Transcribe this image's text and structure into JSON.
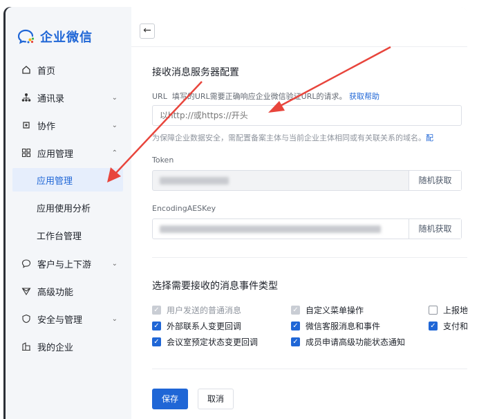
{
  "app": {
    "logo_text": "企业微信"
  },
  "sidebar": {
    "items": [
      {
        "label": "首页",
        "icon": "home-icon"
      },
      {
        "label": "通讯录",
        "icon": "org-chart-icon",
        "chevron": "chevron-down"
      },
      {
        "label": "协作",
        "icon": "collaboration-icon",
        "chevron": "chevron-down"
      },
      {
        "label": "应用管理",
        "icon": "apps-grid-icon",
        "chevron": "chevron-up"
      },
      {
        "label": "客户与上下游",
        "icon": "chat-bubble-icon",
        "chevron": "chevron-down"
      },
      {
        "label": "高级功能",
        "icon": "diamond-icon"
      },
      {
        "label": "安全与管理",
        "icon": "shield-icon",
        "chevron": "chevron-down"
      },
      {
        "label": "我的企业",
        "icon": "building-icon"
      }
    ],
    "sub_items": [
      {
        "label": "应用管理",
        "active": true
      },
      {
        "label": "应用使用分析"
      },
      {
        "label": "工作台管理"
      }
    ]
  },
  "main": {
    "back_label": "←",
    "section1_title": "接收消息服务器配置",
    "url": {
      "label_prefix": "URL",
      "label_desc": "填写的URL需要正确响应企业微信验证URL的请求。",
      "help_link": "获取帮助",
      "placeholder": "以http://或https://开头",
      "hint": "为保障企业数据安全，需配置备案主体与当前企业主体相同或有关联关系的域名。",
      "hint_more": "配"
    },
    "token": {
      "label": "Token",
      "random_button": "随机获取"
    },
    "aes_key": {
      "label": "EncodingAESKey",
      "random_button": "随机获取"
    },
    "section2_title": "选择需要接收的消息事件类型",
    "events": [
      {
        "label": "用户发送的普通消息",
        "state": "disabled"
      },
      {
        "label": "自定义菜单操作",
        "state": "disabled"
      },
      {
        "label": "上报地",
        "state": "unchecked"
      },
      {
        "label": "外部联系人变更回调",
        "state": "checked"
      },
      {
        "label": "微信客服消息和事件",
        "state": "checked"
      },
      {
        "label": "支付和",
        "state": "checked"
      },
      {
        "label": "会议室预定状态变更回调",
        "state": "checked"
      },
      {
        "label": "成员申请高级功能状态通知",
        "state": "checked"
      }
    ],
    "save_button": "保存",
    "cancel_button": "取消"
  },
  "colors": {
    "accent": "#1f66d6",
    "annotation_arrow": "#e8453c",
    "sidebar_bg": "#f4f6f9",
    "active_bg": "#e6eefc"
  }
}
